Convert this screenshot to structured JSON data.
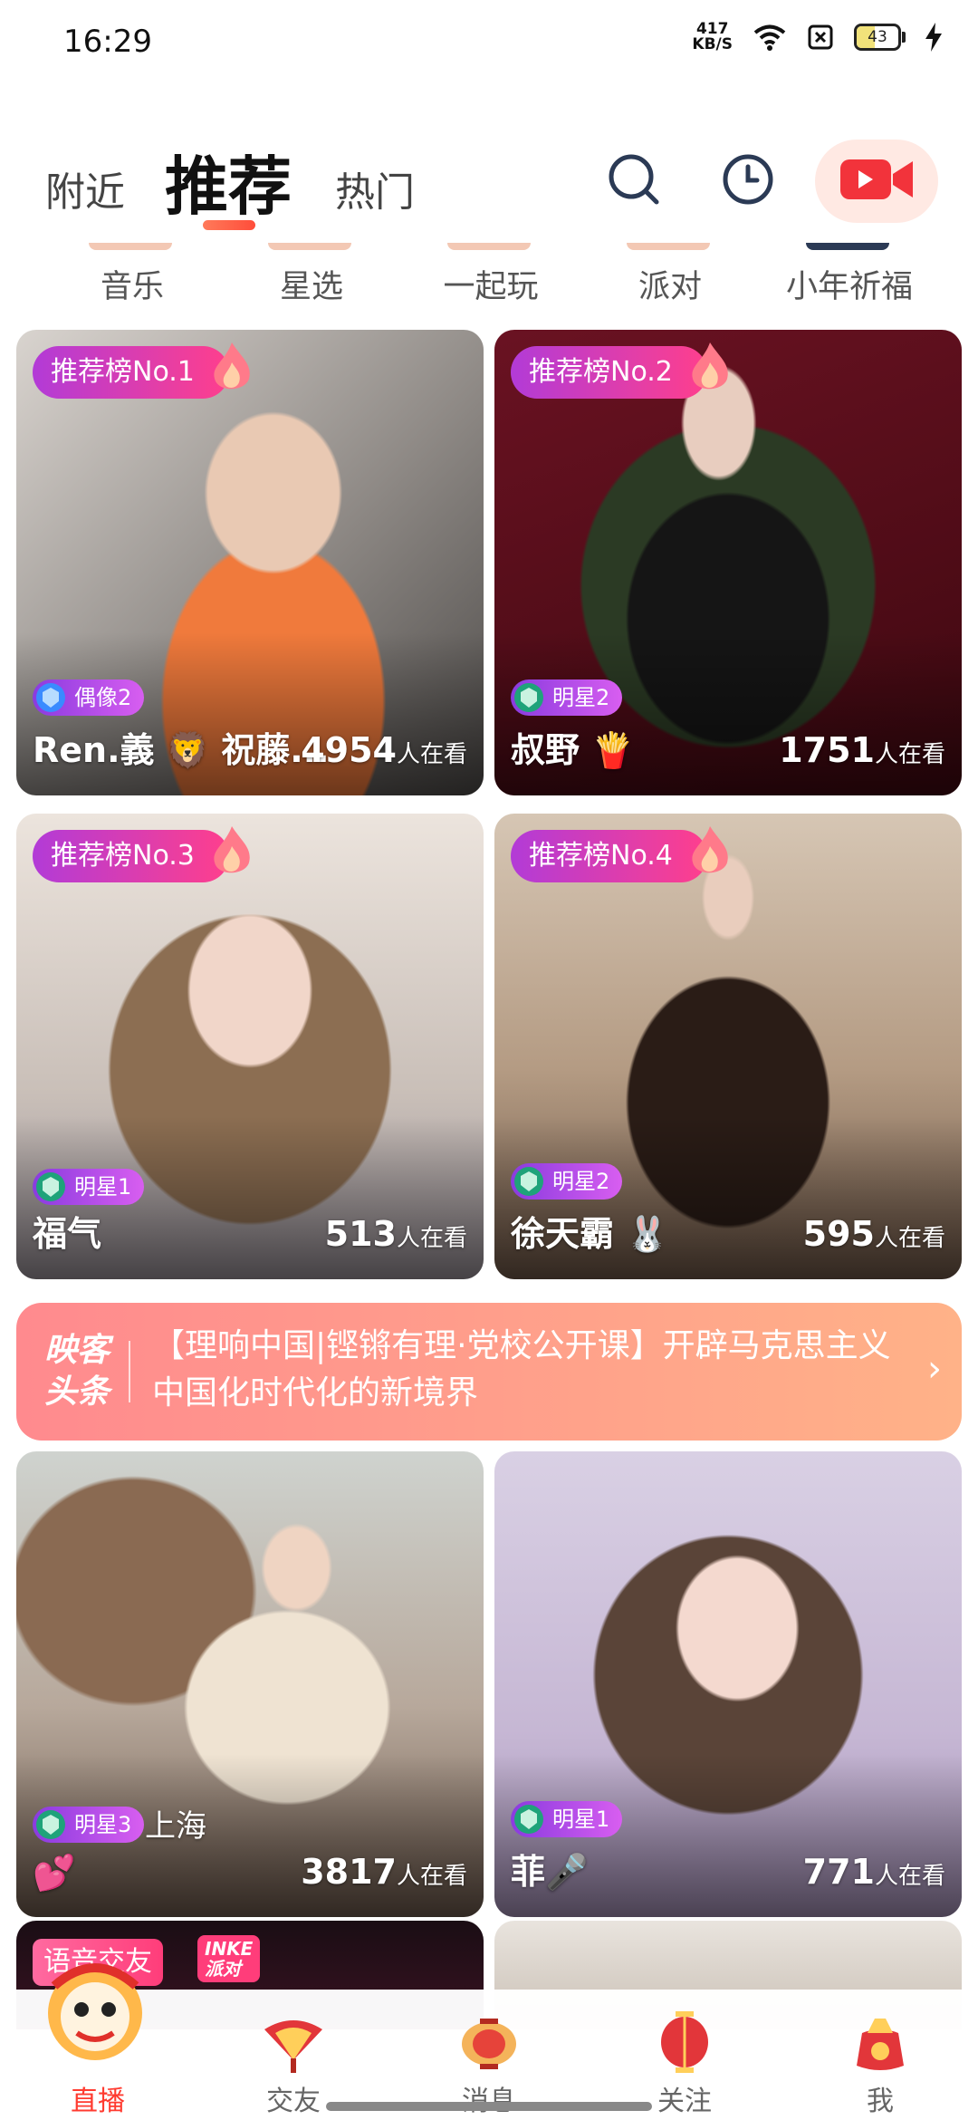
{
  "status_bar": {
    "time": "16:29",
    "net_speed_value": "417",
    "net_speed_unit": "KB/S",
    "battery": "43",
    "battery_level": 0.43,
    "icons": [
      "wifi-icon",
      "sim-icon",
      "battery-icon",
      "charging-icon"
    ]
  },
  "top_nav": {
    "tabs": [
      {
        "label": "附近"
      },
      {
        "label": "推荐",
        "active": true
      },
      {
        "label": "热门"
      }
    ],
    "icons": [
      "search-icon",
      "history-icon",
      "video-camera-icon"
    ]
  },
  "categories": [
    {
      "label": "音乐"
    },
    {
      "label": "星选"
    },
    {
      "label": "一起玩"
    },
    {
      "label": "派对"
    },
    {
      "label": "小年祈福"
    }
  ],
  "cards": [
    {
      "rank": "推荐榜No.1",
      "level": "偶像2",
      "name": "Ren.義 🦁 祝藤...",
      "viewers": "4954",
      "viewers_unit": "人在看"
    },
    {
      "rank": "推荐榜No.2",
      "level": "明星2",
      "name": "叔野 🍟",
      "viewers": "1751",
      "viewers_unit": "人在看"
    },
    {
      "rank": "推荐榜No.3",
      "level": "明星1",
      "name": "福气",
      "viewers": "513",
      "viewers_unit": "人在看"
    },
    {
      "rank": "推荐榜No.4",
      "level": "明星2",
      "name": "徐天霸 🐰",
      "viewers": "595",
      "viewers_unit": "人在看"
    },
    {
      "level": "明星3",
      "city": "上海",
      "name": "💕",
      "viewers": "3817",
      "viewers_unit": "人在看"
    },
    {
      "level": "明星1",
      "name": "菲🎤",
      "viewers": "771",
      "viewers_unit": "人在看"
    }
  ],
  "news_banner": {
    "logo_line1": "映客",
    "logo_line2": "头条",
    "text": "【理响中国|铿锵有理·党校公开课】开辟马克思主义中国化时代化的新境界",
    "arrow": "›"
  },
  "partial_cards": {
    "voice_badge": "语音交友",
    "inke_line1": "INKE",
    "inke_line2": "派对"
  },
  "bottom_nav": [
    {
      "label": "直播",
      "active": true,
      "icon": "lion-dance-icon"
    },
    {
      "label": "交友",
      "icon": "fan-icon"
    },
    {
      "label": "消息",
      "icon": "lantern-icon"
    },
    {
      "label": "关注",
      "icon": "red-lantern-icon"
    },
    {
      "label": "我",
      "icon": "lucky-bag-icon"
    }
  ],
  "colors": {
    "accent": "#ff3b30",
    "rank_badge_start": "#b23bd7",
    "rank_badge_end": "#ff3f8c",
    "banner_start": "#ff8a8e",
    "banner_end": "#ffb288"
  }
}
